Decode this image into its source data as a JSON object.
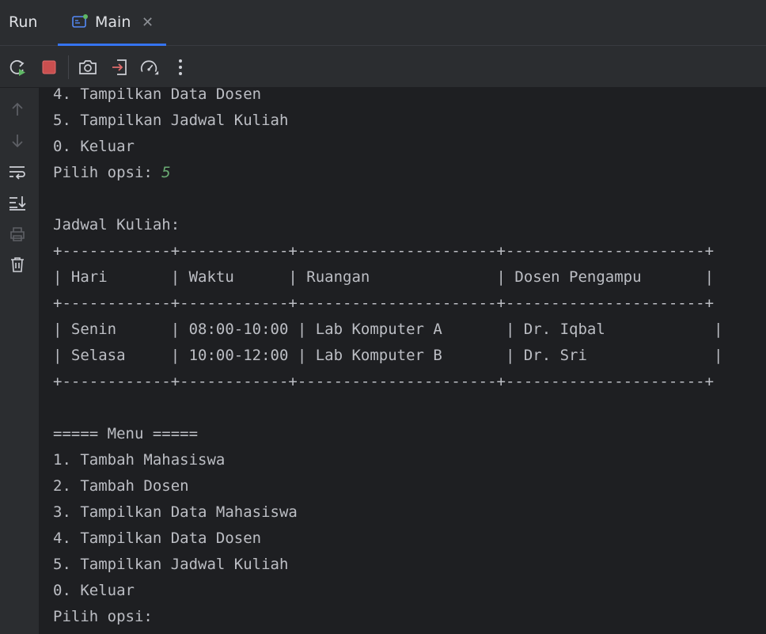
{
  "tabbar": {
    "run_label": "Run",
    "tab_label": "Main"
  },
  "toolbar": {
    "buttons": [
      "rerun-icon",
      "stop-icon",
      "screenshot-icon",
      "exit-icon",
      "profiler-icon",
      "more-icon"
    ]
  },
  "gutter": {
    "buttons": [
      "arrow-up-icon",
      "arrow-down-icon",
      "soft-wrap-icon",
      "scroll-to-end-icon",
      "print-icon",
      "trash-icon"
    ]
  },
  "console": {
    "lines": [
      "4. Tampilkan Data Dosen",
      "5. Tampilkan Jadwal Kuliah",
      "0. Keluar",
      "Pilih opsi: ",
      "",
      "Jadwal Kuliah:",
      "+------------+------------+----------------------+----------------------+",
      "| Hari       | Waktu      | Ruangan              | Dosen Pengampu       |",
      "+------------+------------+----------------------+----------------------+",
      "| Senin      | 08:00-10:00 | Lab Komputer A       | Dr. Iqbal            |",
      "| Selasa     | 10:00-12:00 | Lab Komputer B       | Dr. Sri              |",
      "+------------+------------+----------------------+----------------------+",
      "",
      "===== Menu =====",
      "1. Tambah Mahasiswa",
      "2. Tambah Dosen",
      "3. Tampilkan Data Mahasiswa",
      "4. Tampilkan Data Dosen",
      "5. Tampilkan Jadwal Kuliah",
      "0. Keluar",
      "Pilih opsi:"
    ],
    "user_input": "5",
    "input_line_index": 3
  },
  "colors": {
    "background": "#1e1f22",
    "panel": "#2b2d30",
    "text": "#bcbec4",
    "input": "#6aab73",
    "accent": "#3574f0"
  }
}
